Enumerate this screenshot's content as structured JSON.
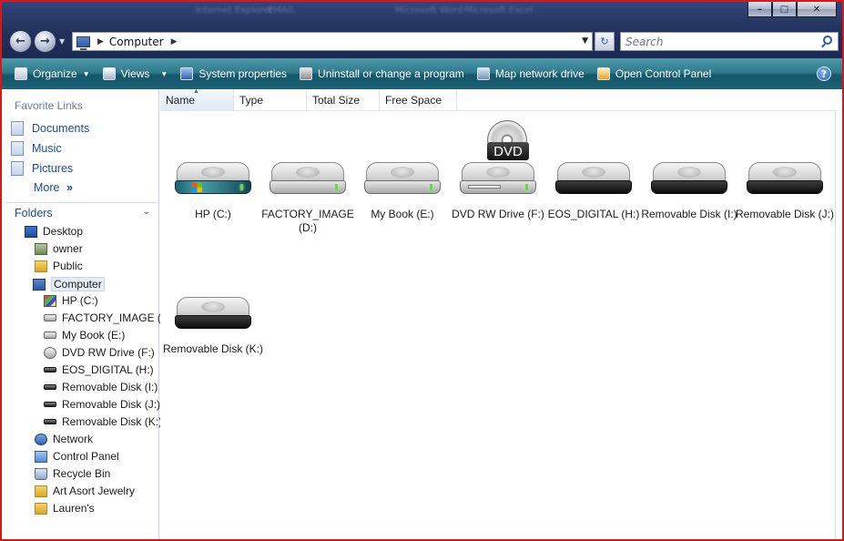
{
  "titlebar": {
    "blurred": [
      "Internet Explorer",
      "EMAIL",
      "Microsoft Word",
      "Microsoft Excel"
    ],
    "controls": [
      "minimize-icon",
      "maximize-icon",
      "close-icon"
    ]
  },
  "address": {
    "path": "Computer",
    "search_placeholder": "Search"
  },
  "toolbar": {
    "organize": "Organize",
    "views": "Views",
    "system_properties": "System properties",
    "uninstall": "Uninstall or change a program",
    "map_drive": "Map network drive",
    "control_panel": "Open Control Panel",
    "help": "?"
  },
  "favorites": {
    "header": "Favorite Links",
    "items": [
      "Documents",
      "Music",
      "Pictures"
    ],
    "more": "More"
  },
  "folders": {
    "header": "Folders",
    "tree": [
      "Desktop",
      "owner",
      "Public",
      "Computer",
      "HP (C:)",
      "FACTORY_IMAGE (D",
      "My Book (E:)",
      "DVD RW Drive (F:)",
      "EOS_DIGITAL (H:)",
      "Removable Disk (I:)",
      "Removable Disk (J:)",
      "Removable Disk (K:)",
      "Network",
      "Control Panel",
      "Recycle Bin",
      "Art Asort Jewelry",
      "Lauren's"
    ]
  },
  "columns": [
    "Name",
    "Type",
    "Total Size",
    "Free Space"
  ],
  "drives": [
    {
      "name": "HP (C:)",
      "icon": "hdd-windows-icon"
    },
    {
      "name": "FACTORY_IMAGE (D:)",
      "icon": "hdd-icon"
    },
    {
      "name": "My Book (E:)",
      "icon": "hdd-icon"
    },
    {
      "name": "DVD RW Drive (F:)",
      "icon": "dvd-drive-icon",
      "badge": "DVD"
    },
    {
      "name": "EOS_DIGITAL (H:)",
      "icon": "removable-disk-icon"
    },
    {
      "name": "Removable Disk (I:)",
      "icon": "removable-disk-icon"
    },
    {
      "name": "Removable Disk (J:)",
      "icon": "removable-disk-icon"
    },
    {
      "name": "Removable Disk (K:)",
      "icon": "removable-disk-icon"
    }
  ],
  "colors": {
    "frame": "#d11a1a",
    "command_bar": "#2f7a8b",
    "link": "#1f4b94"
  }
}
